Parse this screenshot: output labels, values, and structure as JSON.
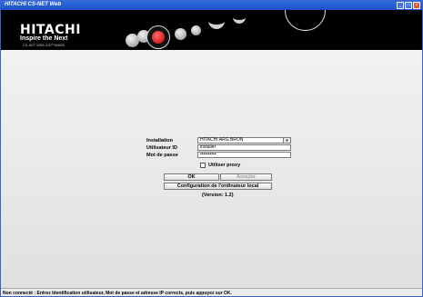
{
  "window": {
    "title": "HITACHI CS-NET Web",
    "controls": {
      "minimize": "_",
      "maximize": "□",
      "close": "×"
    }
  },
  "banner": {
    "logo": "HITACHI",
    "tagline": "Inspire the Next",
    "subtitle": "CS-NET WEB SOFTWARE"
  },
  "form": {
    "installation_label": "Installation",
    "installation_value": "HITACHI ARG BRON",
    "user_label": "Utilisateur ID",
    "user_value": "installer",
    "password_label": "Mot de passe",
    "password_value": "••••••••••",
    "proxy_label": "Utiliser proxy",
    "proxy_checked": false
  },
  "buttons": {
    "ok": "OK",
    "cancel": "Annuler",
    "config": "Configuration de l'ordinateur local"
  },
  "version": "(Version: 1.2)",
  "status": {
    "message": "Non connecté : Entrez Identification utilisateur, Mot de passe et adresse IP corrects, puis appuyez sur OK."
  },
  "colors": {
    "titlebar": "#1e4fc4",
    "banner": "#000000",
    "accent_red": "#e32020"
  }
}
